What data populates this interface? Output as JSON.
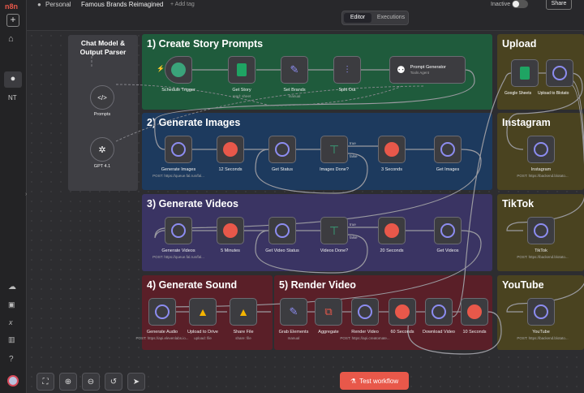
{
  "header": {
    "workspace": "Personal",
    "workflow_name": "Famous Brands Reimagined",
    "add_tag": "+ Add tag",
    "tab_editor": "Editor",
    "tab_executions": "Executions",
    "status": "Inactive",
    "share": "Share"
  },
  "sidebar": {
    "user_initials": "NT",
    "icons": [
      "add-icon",
      "home-icon",
      "user-icon",
      "cloud-icon",
      "inbox-icon",
      "variables-icon",
      "insights-icon",
      "help-icon"
    ]
  },
  "groups": {
    "chat": "Chat Model & Output Parser",
    "story": "1) Create Story Prompts",
    "images": "2) Generate Images",
    "videos": "3) Generate Videos",
    "sound": "4) Generate Sound",
    "render": "5) Render Video",
    "upload": "Upload",
    "instagram": "Instagram",
    "tiktok": "TikTok",
    "youtube": "YouTube"
  },
  "nodes": {
    "prompts": "Prompts",
    "gpt": "GPT 4.1",
    "schedule": "Schedule Trigger",
    "get_story": "Get Story",
    "get_story_sub": "read: sheet",
    "set_brands": "Set Brands",
    "set_brands_sub": "manual",
    "split_out": "Split Out",
    "prompt_gen": "Prompt Generator",
    "prompt_gen_sub": "Tools Agent",
    "gen_images": "Generate Images",
    "gen_images_sub": "POST: https://queue.fal.run/fal...",
    "sec12": "12 Seconds",
    "get_status": "Get Status",
    "images_done": "Images Done?",
    "sec3": "3 Seconds",
    "get_images": "Get Images",
    "gen_videos": "Generate Videos",
    "gen_videos_sub": "POST: https://queue.fal.run/fal...",
    "min5": "5 Minutes",
    "get_video_status": "Get Video Status",
    "videos_done": "Videos Done?",
    "sec20": "20 Seconds",
    "get_videos": "Get Videos",
    "gen_audio": "Generate Audio",
    "gen_audio_sub": "POST: https://api.elevenlabs.io...",
    "upload_drive": "Upload to Drive",
    "upload_drive_sub": "upload: file",
    "share_file": "Share File",
    "share_file_sub": "share: file",
    "grab_elements": "Grab Elements",
    "grab_elements_sub": "manual",
    "aggregate": "Aggregate",
    "render_video": "Render Video",
    "render_video_sub": "POST: https://api.creatomate...",
    "sec60": "60 Seconds",
    "download_video": "Download Video",
    "sec10": "10 Seconds",
    "gsheets": "Google Sheets",
    "upload_blotato": "Upload to Blotato",
    "instagram": "Instagram",
    "tiktok": "TikTok",
    "youtube": "YouTube",
    "post_sub": "POST: https://backend.blotato..."
  },
  "branch": {
    "true": "true",
    "false": "false"
  },
  "footer": {
    "test_workflow": "Test workflow"
  },
  "colors": {
    "green": "#1f5b3c",
    "blue": "#1d3a5e",
    "purple": "#3a3463",
    "red": "#5a1f28",
    "olive": "#4a4320",
    "orange": "#e8584a"
  }
}
